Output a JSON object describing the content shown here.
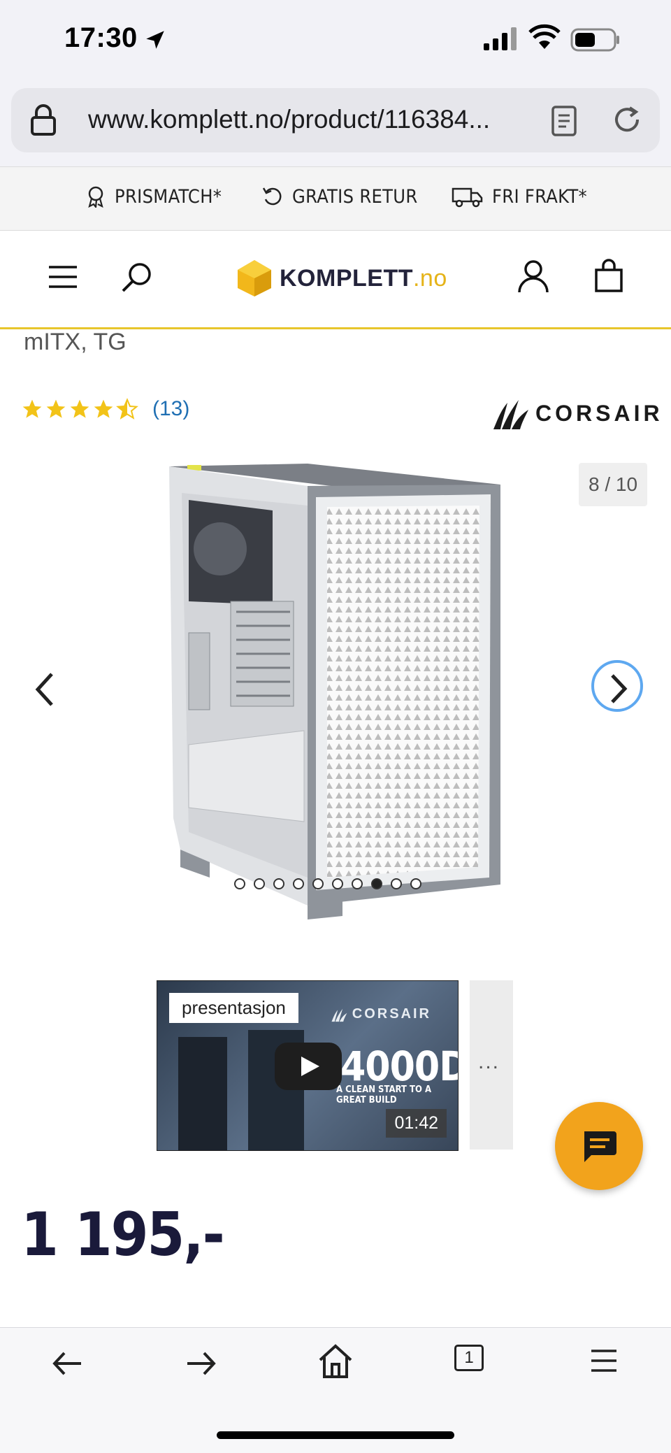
{
  "status_bar": {
    "time": "17:30",
    "icons": [
      "location-arrow-icon",
      "signal-icon",
      "wifi-icon",
      "battery-icon"
    ]
  },
  "browser": {
    "url": "www.komplett.no/product/116384...",
    "icons": [
      "lock-icon",
      "reader-icon",
      "reload-icon"
    ]
  },
  "usp_bar": {
    "items": [
      {
        "icon": "award-icon",
        "label": "PRISMATCH*"
      },
      {
        "icon": "return-icon",
        "label": "GRATIS RETUR"
      },
      {
        "icon": "truck-icon",
        "label": "FRI FRAKT*"
      }
    ]
  },
  "header": {
    "logo_text": "KOMPLETT",
    "logo_suffix": ".no",
    "icons": [
      "menu-icon",
      "search-icon",
      "account-icon",
      "cart-icon"
    ]
  },
  "product": {
    "subtitle": "mITX, TG",
    "rating_stars": 4.5,
    "review_count": "(13)",
    "brand": "CORSAIR",
    "image_counter": "8 / 10",
    "active_image_index": 8,
    "image_count": 10
  },
  "media": {
    "video_label": "presentasjon",
    "video_brand": "CORSAIR",
    "video_title": "4000D",
    "video_tagline": "A CLEAN START TO A GREAT BUILD",
    "video_duration": "01:42",
    "more_label": "..."
  },
  "price": {
    "value": "1 195,-"
  },
  "toolbar": {
    "tab_count": "1",
    "icons": [
      "back-icon",
      "forward-icon",
      "home-icon",
      "tabs-icon",
      "menu-icon"
    ]
  },
  "colors": {
    "accent_yellow": "#e8c62c",
    "chat_button": "#f2a31c",
    "link_blue": "#1f6fb3",
    "star_yellow": "#f2c318"
  }
}
